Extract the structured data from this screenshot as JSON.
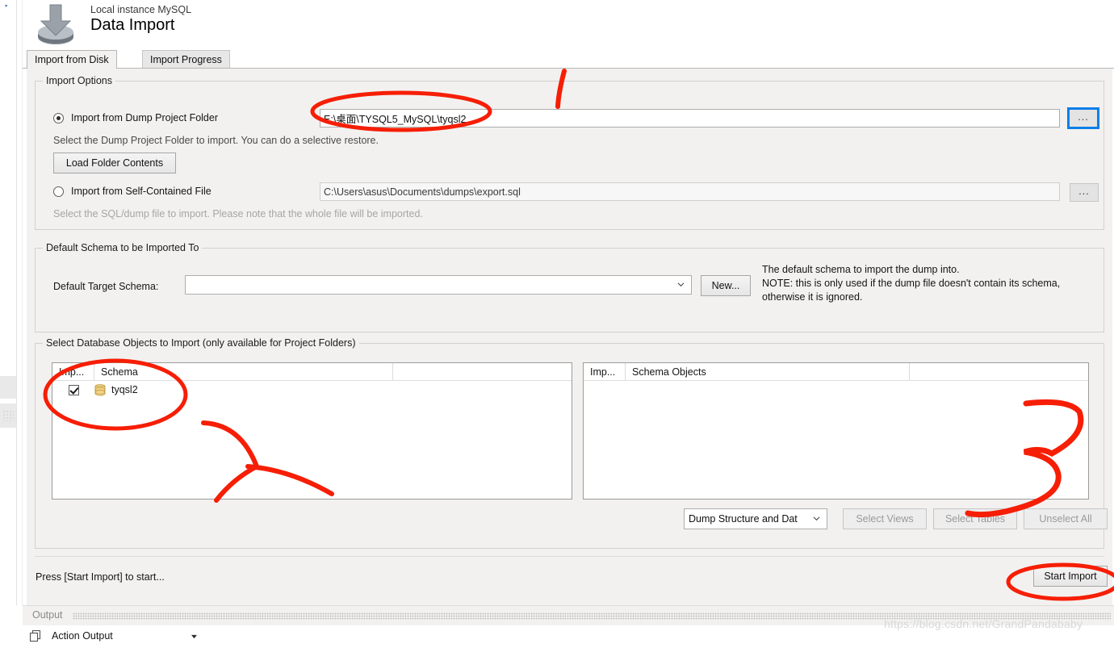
{
  "header": {
    "subtitle": "Local instance MySQL",
    "title": "Data Import",
    "icon": "import-arrow-icon"
  },
  "tabs": [
    {
      "label": "Import from Disk",
      "active": true
    },
    {
      "label": "Import Progress",
      "active": false
    }
  ],
  "import_options": {
    "group_title": "Import Options",
    "folder_radio": {
      "label": "Import from Dump Project Folder",
      "selected": true,
      "path_value": "E:\\桌面\\TYSQL5_MySQL\\tyqsl2",
      "browse_label": "...",
      "browse_focused": true
    },
    "folder_hint": "Select the Dump Project Folder to import. You can do a selective restore.",
    "load_folder_button": "Load Folder Contents",
    "file_radio": {
      "label": "Import from Self-Contained File",
      "selected": false,
      "path_value": "C:\\Users\\asus\\Documents\\dumps\\export.sql",
      "browse_label": "...",
      "disabled": true
    },
    "file_hint": "Select the SQL/dump file to import. Please note that the whole file will be imported."
  },
  "default_schema": {
    "group_title": "Default Schema to be Imported To",
    "field_label": "Default Target Schema:",
    "field_value": "",
    "new_button": "New...",
    "note_lines": [
      "The default schema to import the dump into.",
      "NOTE: this is only used if the dump file doesn't contain its schema,",
      "otherwise it is ignored."
    ]
  },
  "objects": {
    "group_title": "Select Database Objects to Import (only available for Project Folders)",
    "left_list": {
      "columns": [
        "Imp...",
        "Schema",
        ""
      ],
      "rows": [
        {
          "checked": true,
          "icon": "database-icon",
          "name": "tyqsl2"
        }
      ]
    },
    "right_list": {
      "columns": [
        "Imp...",
        "Schema Objects",
        ""
      ],
      "rows": []
    },
    "dump_mode_value": "Dump Structure and Dat",
    "buttons": [
      {
        "label": "Select Views",
        "disabled": true
      },
      {
        "label": "Select Tables",
        "disabled": true
      },
      {
        "label": "Unselect All",
        "disabled": true
      }
    ]
  },
  "status": {
    "message": "Press [Start Import] to start...",
    "start_button": "Start Import"
  },
  "output": {
    "panel_label": "Output",
    "action_output_label": "Action Output"
  },
  "watermark": "https://blog.csdn.net/GrandPandababy",
  "colors": {
    "annotation_red": "#f61e05",
    "focus_blue": "#0a7fe8",
    "panel_bg": "#f2f1f0"
  }
}
